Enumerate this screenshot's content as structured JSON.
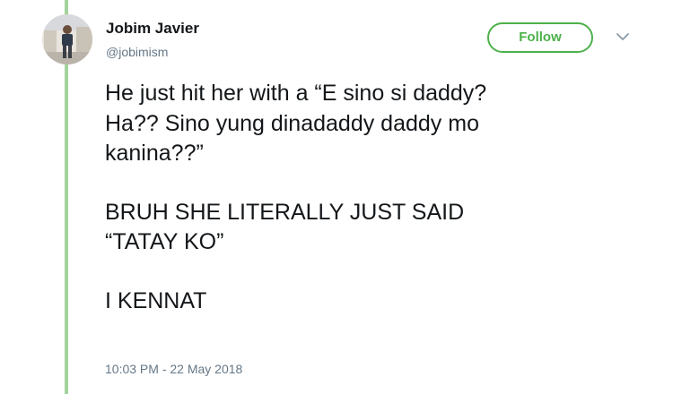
{
  "user": {
    "name": "Jobim Javier",
    "handle": "@jobimism"
  },
  "actions": {
    "follow_label": "Follow",
    "menu_icon": "chevron-down-icon"
  },
  "tweet": {
    "paragraphs": [
      "He just hit her with a “E sino si daddy?\nHa?? Sino yung dinadaddy daddy mo\nkanina??”",
      "BRUH SHE LITERALLY JUST SAID\n“TATAY KO”",
      "I KENNAT"
    ],
    "timestamp": "10:03 PM - 22 May 2018"
  },
  "colors": {
    "accent_green": "#4db14a",
    "thread_line": "#a3d39c",
    "text_primary": "#14171a",
    "text_secondary": "#657786"
  }
}
